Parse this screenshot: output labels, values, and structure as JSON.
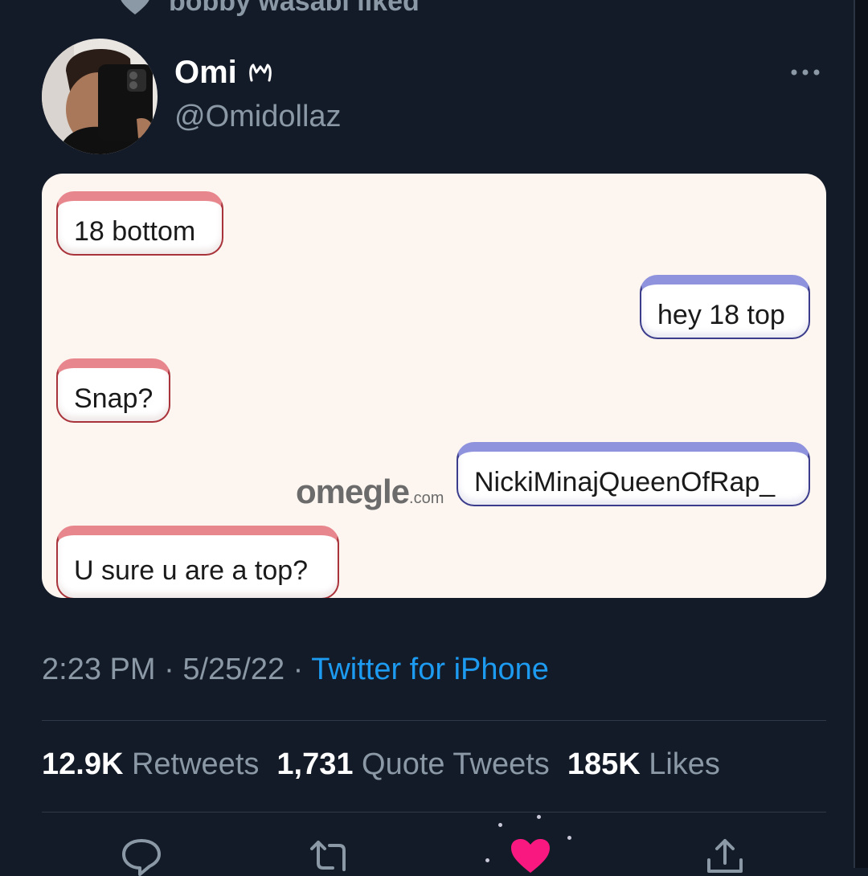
{
  "context": {
    "text": "bobby wasabi liked",
    "icon": "heart-icon"
  },
  "tweet": {
    "author_name": "Omi",
    "author_handle": "@Omidollaz",
    "name_badge_icon": "crown-icon",
    "more_icon": "more-options-icon",
    "image": {
      "messages": [
        {
          "sender": "stranger",
          "text": "18 bottom"
        },
        {
          "sender": "you",
          "text": "hey 18 top"
        },
        {
          "sender": "stranger",
          "text": "Snap?"
        },
        {
          "sender": "you",
          "text": "NickiMinajQueenOfRap_"
        },
        {
          "sender": "stranger",
          "text": "U sure u are a top?"
        }
      ],
      "logo_text": "omegle",
      "logo_domain": ".com"
    },
    "time": "2:23 PM",
    "date": "5/25/22",
    "separator": " · ",
    "source": "Twitter for iPhone"
  },
  "stats": {
    "retweets": {
      "value": "12.9K",
      "label": "Retweets"
    },
    "quote_tweets": {
      "value": "1,731",
      "label": "Quote Tweets"
    },
    "likes": {
      "value": "185K",
      "label": "Likes"
    }
  },
  "actions": [
    "reply-icon",
    "retweet-icon",
    "like-icon",
    "share-icon"
  ],
  "colors": {
    "background": "#141b28",
    "text_secondary": "#8b98a5",
    "link": "#1d9bf0",
    "like_active": "#f91880"
  }
}
